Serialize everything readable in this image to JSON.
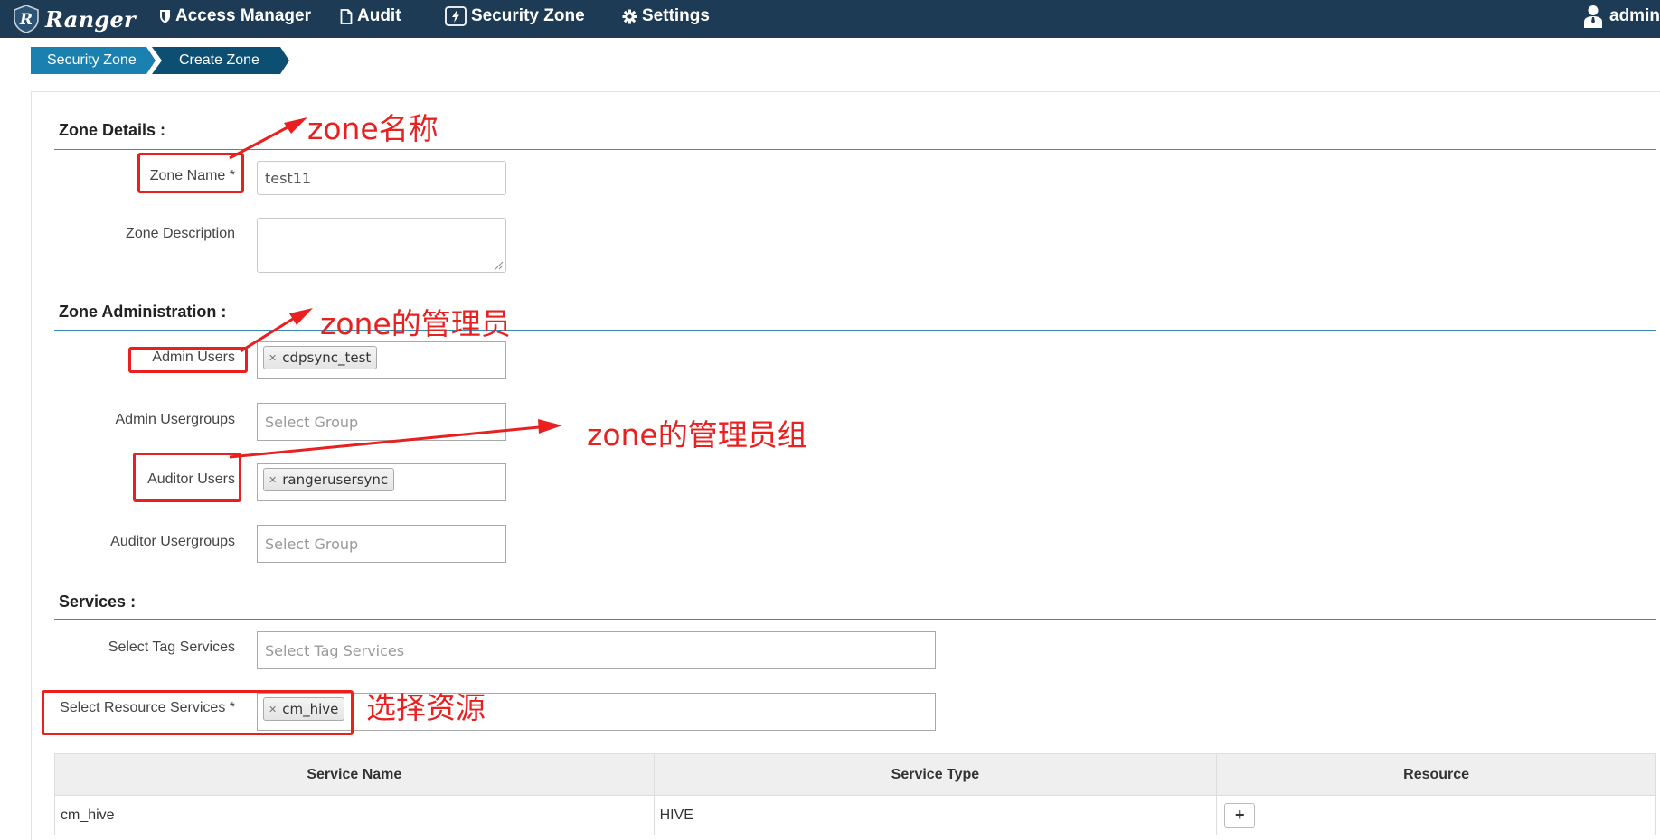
{
  "app": {
    "brand": "Ranger"
  },
  "nav": {
    "access_manager": "Access Manager",
    "audit": "Audit",
    "security_zone": "Security Zone",
    "settings": "Settings",
    "user": "admin"
  },
  "breadcrumb": [
    "Security Zone",
    "Create Zone"
  ],
  "zone_details": {
    "title": "Zone Details :",
    "zone_name_label": "Zone Name *",
    "zone_name_value": "test11",
    "zone_description_label": "Zone Description",
    "zone_description_value": ""
  },
  "zone_admin": {
    "title": "Zone Administration :",
    "admin_users_label": "Admin Users",
    "admin_users": [
      "cdpsync_test"
    ],
    "admin_usergroups_label": "Admin Usergroups",
    "admin_usergroups_placeholder": "Select Group",
    "auditor_users_label": "Auditor Users",
    "auditor_users": [
      "rangerusersync"
    ],
    "auditor_usergroups_label": "Auditor Usergroups",
    "auditor_usergroups_placeholder": "Select Group"
  },
  "services": {
    "title": "Services :",
    "tag_services_label": "Select Tag Services",
    "tag_services_placeholder": "Select Tag Services",
    "resource_services_label": "Select Resource Services *",
    "resource_services": [
      "cm_hive"
    ],
    "table": {
      "headers": [
        "Service Name",
        "Service Type",
        "Resource"
      ],
      "rows": [
        {
          "name": "cm_hive",
          "type": "HIVE",
          "add_label": "+"
        }
      ]
    }
  },
  "annotations": {
    "zone_name": "zone名称",
    "zone_admin": "zone的管理员",
    "zone_admin_group": "zone的管理员组",
    "resource": "选择资源"
  },
  "colors": {
    "navbar": "#1d3b55",
    "breadcrumb_primary": "#1a80b0",
    "breadcrumb_active": "#0d4f73",
    "section_line": "#3a8ab4",
    "annotation": "#e8201f"
  }
}
